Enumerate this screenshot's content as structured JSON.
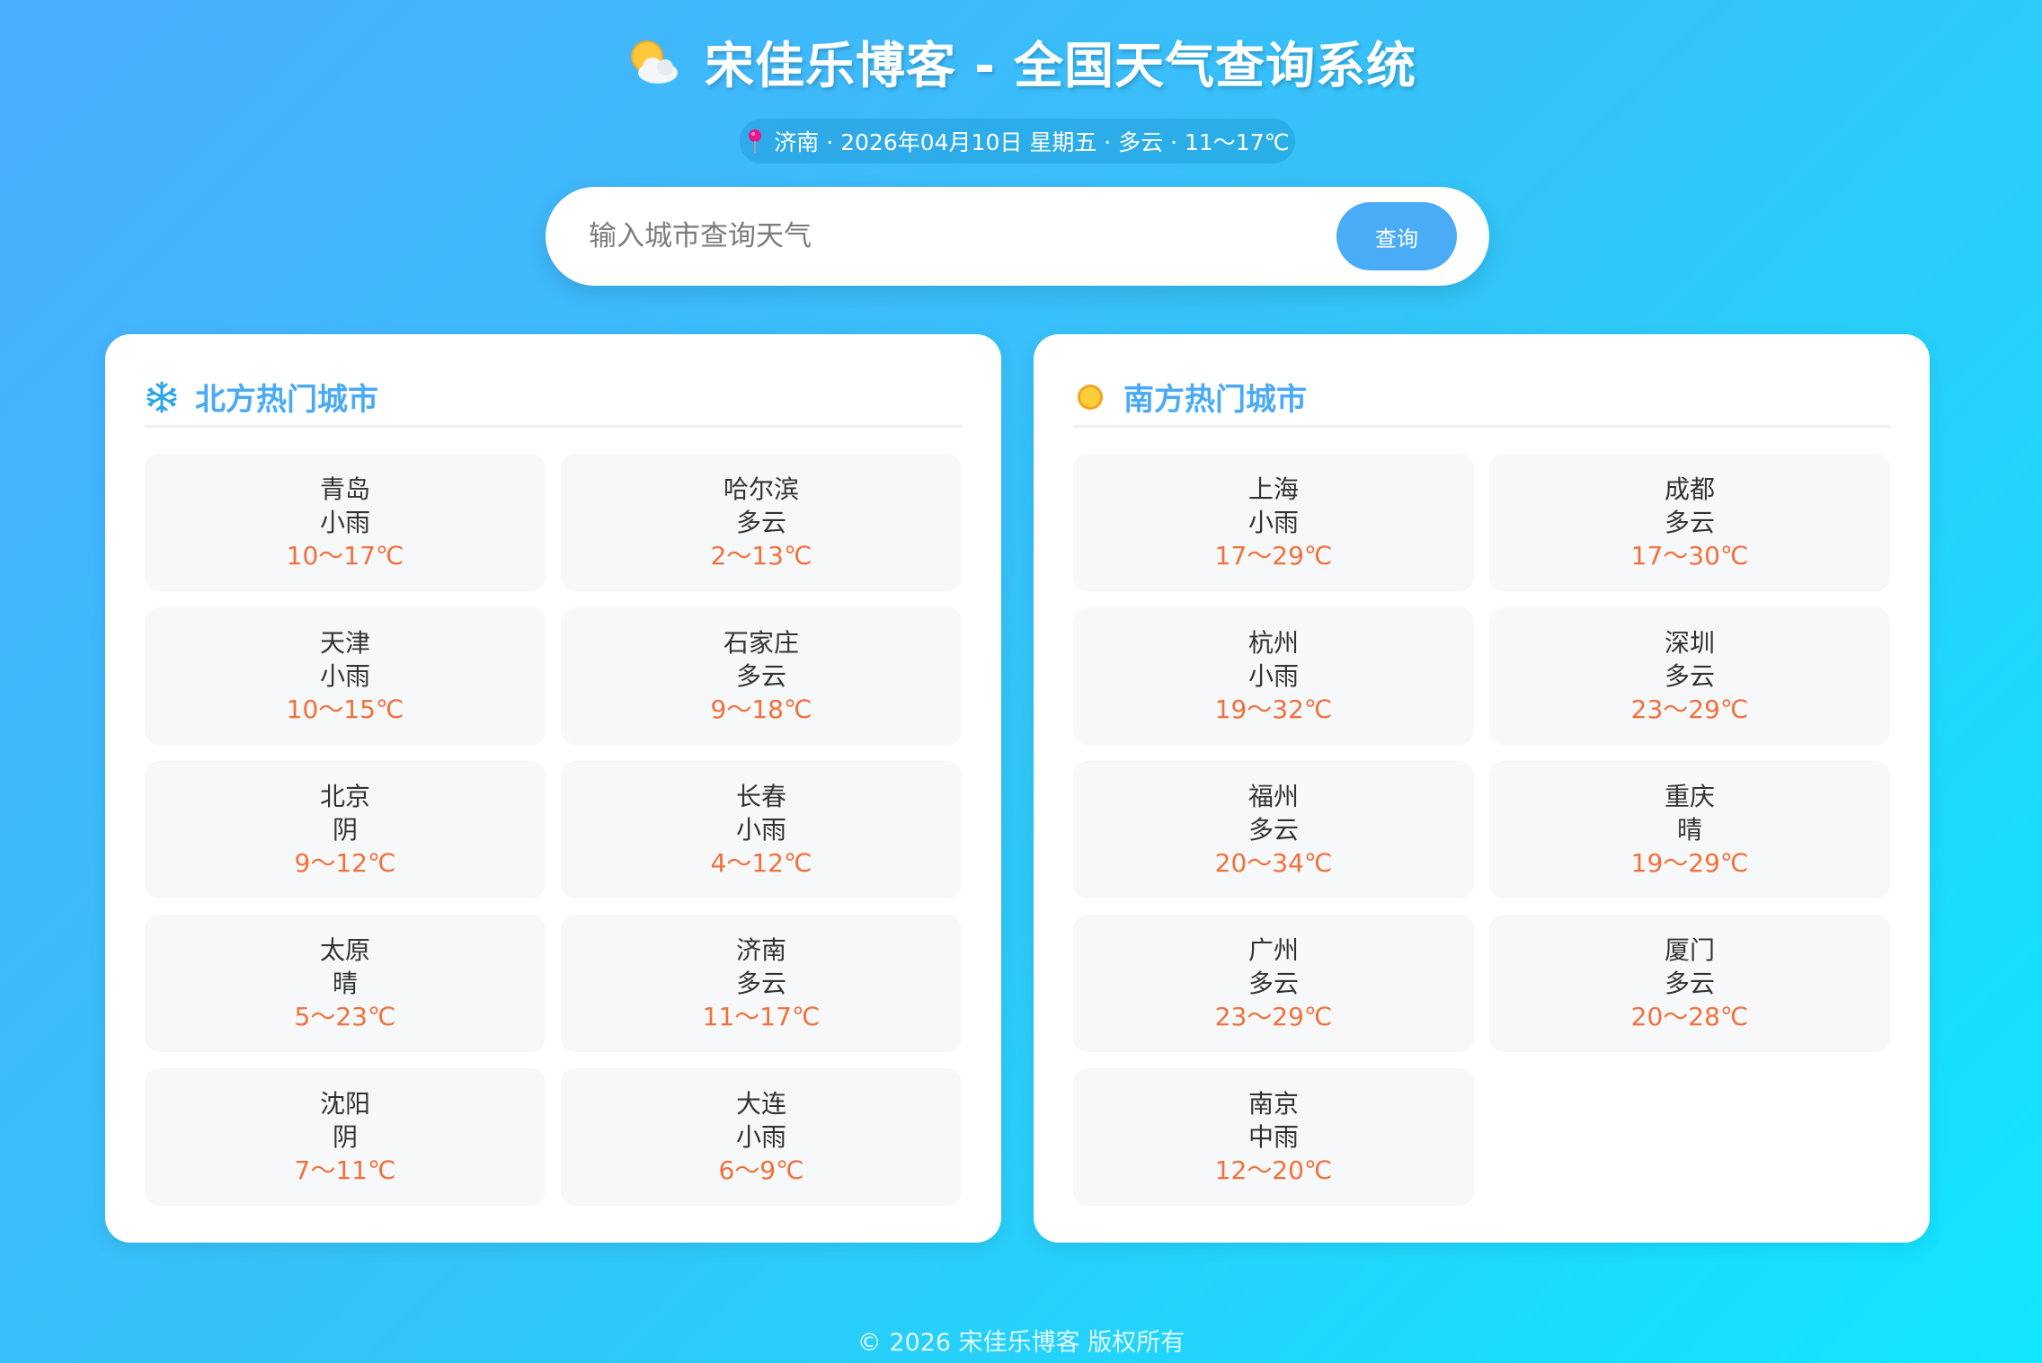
{
  "header": {
    "title": "宋佳乐博客 - 全国天气查询系统",
    "icon": "sun-behind-cloud-icon"
  },
  "today": {
    "text": "济南 · 2026年04月10日 星期五 · 多云 · 11～17℃",
    "icon": "map-pin-icon"
  },
  "search": {
    "placeholder": "输入城市查询天气",
    "value": "",
    "button_label": "查询"
  },
  "north": {
    "title": "北方热门城市",
    "icon": "snowflake-icon",
    "cities": [
      {
        "name": "青岛",
        "condition": "小雨",
        "temp": "10～17℃"
      },
      {
        "name": "哈尔滨",
        "condition": "多云",
        "temp": "2～13℃"
      },
      {
        "name": "天津",
        "condition": "小雨",
        "temp": "10～15℃"
      },
      {
        "name": "石家庄",
        "condition": "多云",
        "temp": "9～18℃"
      },
      {
        "name": "北京",
        "condition": "阴",
        "temp": "9～12℃"
      },
      {
        "name": "长春",
        "condition": "小雨",
        "temp": "4～12℃"
      },
      {
        "name": "太原",
        "condition": "晴",
        "temp": "5～23℃"
      },
      {
        "name": "济南",
        "condition": "多云",
        "temp": "11～17℃"
      },
      {
        "name": "沈阳",
        "condition": "阴",
        "temp": "7～11℃"
      },
      {
        "name": "大连",
        "condition": "小雨",
        "temp": "6～9℃"
      }
    ]
  },
  "south": {
    "title": "南方热门城市",
    "icon": "sun-icon",
    "cities": [
      {
        "name": "上海",
        "condition": "小雨",
        "temp": "17～29℃"
      },
      {
        "name": "成都",
        "condition": "多云",
        "temp": "17～30℃"
      },
      {
        "name": "杭州",
        "condition": "小雨",
        "temp": "19～32℃"
      },
      {
        "name": "深圳",
        "condition": "多云",
        "temp": "23～29℃"
      },
      {
        "name": "福州",
        "condition": "多云",
        "temp": "20～34℃"
      },
      {
        "name": "重庆",
        "condition": "晴",
        "temp": "19～29℃"
      },
      {
        "name": "广州",
        "condition": "多云",
        "temp": "23～29℃"
      },
      {
        "name": "厦门",
        "condition": "多云",
        "temp": "20～28℃"
      },
      {
        "name": "南京",
        "condition": "中雨",
        "temp": "12～20℃"
      }
    ]
  },
  "footer": {
    "text": "© 2026 宋佳乐博客 版权所有"
  },
  "colors": {
    "accent": "#4aabf7",
    "temperature": "#f2703a",
    "card_background": "#f6f8fa",
    "gradient_start": "#4aaeff",
    "gradient_end": "#10e6ff"
  }
}
